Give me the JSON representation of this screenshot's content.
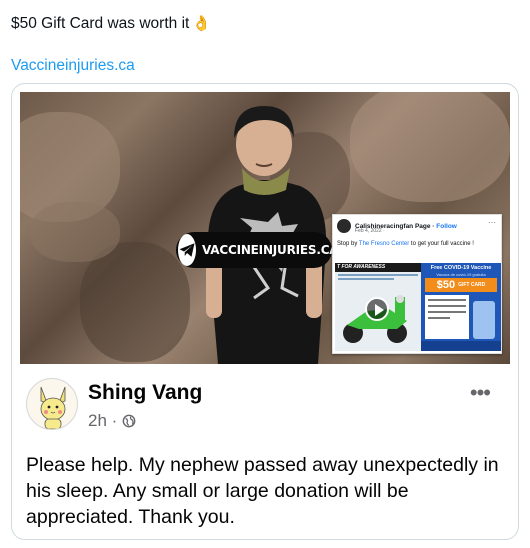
{
  "tweet": {
    "text": "$50 Gift Card was worth it",
    "emoji": "👌",
    "link": "Vaccineinjuries.ca"
  },
  "photo": {
    "watermark_text": "VACCINEINJURIES.CA"
  },
  "inset_post": {
    "page_name": "Calishineracingfan Page",
    "follow_separator": " · ",
    "follow_label": "Follow",
    "date": "Feb 4, 2022 · ",
    "menu": "···",
    "caption_pre": "Stop by ",
    "caption_link": "The Fresno Center",
    "caption_post": " to get your full vaccine !",
    "flyer_banner": "T FOR AWARENESS",
    "flyer_title": "Free COVID-19 Vaccine",
    "flyer_subtitle": "Vacuna de covid-19 gratuita",
    "flyer_amount": "$50",
    "flyer_offer": "GIFT CARD"
  },
  "post": {
    "author": "Shing Vang",
    "time": "2h ·",
    "menu": "•••",
    "body": "Please help. My nephew passed away unexpectedly in his sleep. Any small or large donation will be appreciated.  Thank you."
  }
}
